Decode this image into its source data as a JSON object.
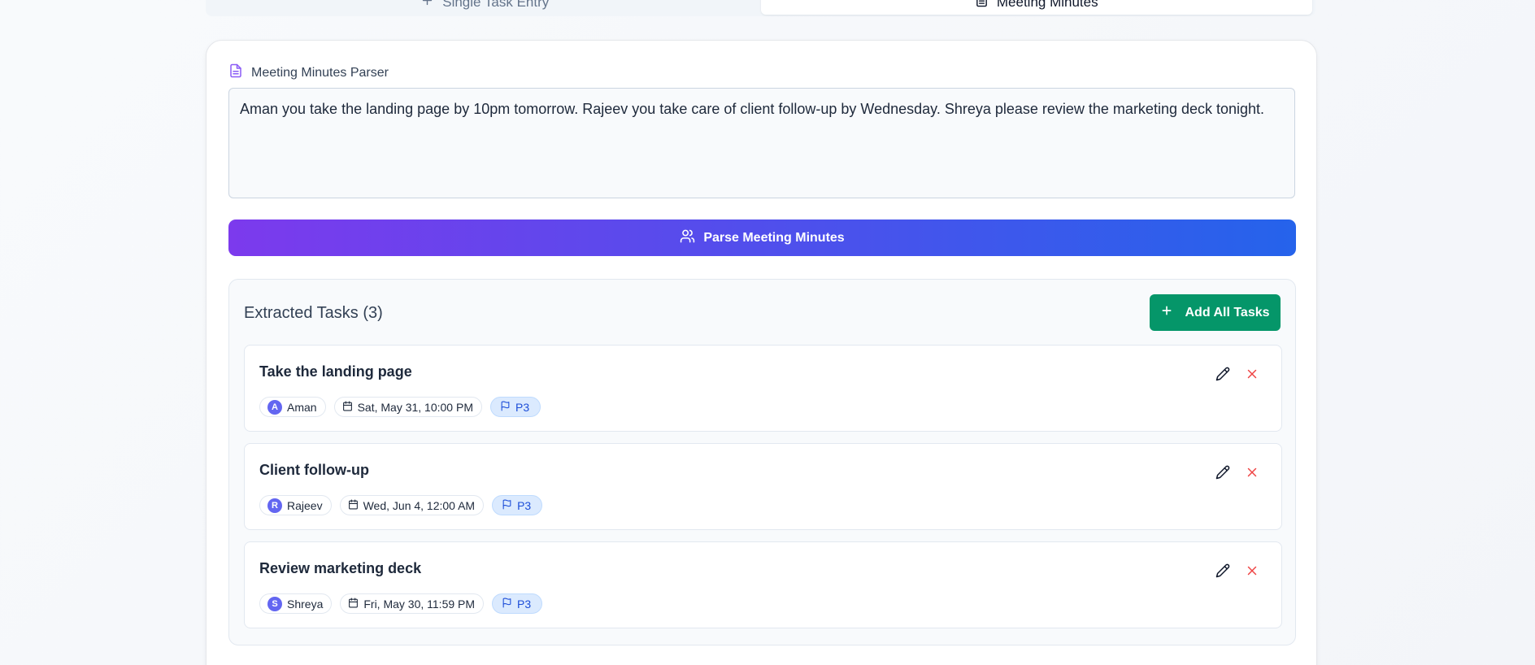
{
  "tabs": [
    {
      "label": "Single Task Entry",
      "icon": "plus-icon",
      "active": false
    },
    {
      "label": "Meeting Minutes",
      "icon": "document-icon",
      "active": true
    }
  ],
  "parser": {
    "heading": "Meeting Minutes Parser",
    "input_value": "Aman you take the landing page by 10pm tomorrow. Rajeev you take care of client follow-up by Wednesday. Shreya please review the marketing deck tonight.",
    "button_label": "Parse Meeting Minutes"
  },
  "extracted": {
    "title": "Extracted Tasks (3)",
    "add_all_label": "Add All Tasks",
    "tasks": [
      {
        "title": "Take the landing page",
        "assignee": "Aman",
        "initial": "A",
        "due": "Sat, May 31, 10:00 PM",
        "priority": "P3"
      },
      {
        "title": "Client follow-up",
        "assignee": "Rajeev",
        "initial": "R",
        "due": "Wed, Jun 4, 12:00 AM",
        "priority": "P3"
      },
      {
        "title": "Review marketing deck",
        "assignee": "Shreya",
        "initial": "S",
        "due": "Fri, May 30, 11:59 PM",
        "priority": "P3"
      }
    ]
  },
  "colors": {
    "gradient_start": "#7c3aed",
    "gradient_end": "#2563eb",
    "add_button": "#059669",
    "delete_icon": "#ef4444",
    "avatar": "#6366f1",
    "priority_bg": "#dbeafe"
  }
}
